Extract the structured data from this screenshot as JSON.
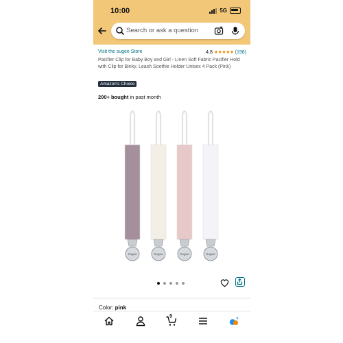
{
  "status_bar": {
    "time": "10:00",
    "network": "5G"
  },
  "header": {
    "search_placeholder": "Search or ask a question"
  },
  "product": {
    "store_link": "Visit the sugee Store",
    "rating": "4.8",
    "rating_count": "(198)",
    "stars": "★★★★★",
    "title": "Pacifier Clip for Baby Boy and Girl - Linen Soft Fabric Pacifier Hold with Clip for Binky, Leash Soothie Holder Unisex 4 Pack (Pink)",
    "badge": "Amazon's Choice",
    "bought_bold": "200+ bought",
    "bought_rest": " in past month",
    "clip_text": "Sugee",
    "strap_colors": [
      "#a58f9c",
      "#f4efe6",
      "#e8c9c9",
      "#f4f4f8"
    ],
    "color_label": "Color:",
    "color_value": "pink"
  },
  "carousel": {
    "count": 5,
    "active": 0
  },
  "bottom_nav": {
    "cart_count": "9"
  },
  "colors": {
    "header_bg": "#f3c778",
    "link": "#007185",
    "star": "#f08804",
    "badge_bg": "#232f3e"
  }
}
